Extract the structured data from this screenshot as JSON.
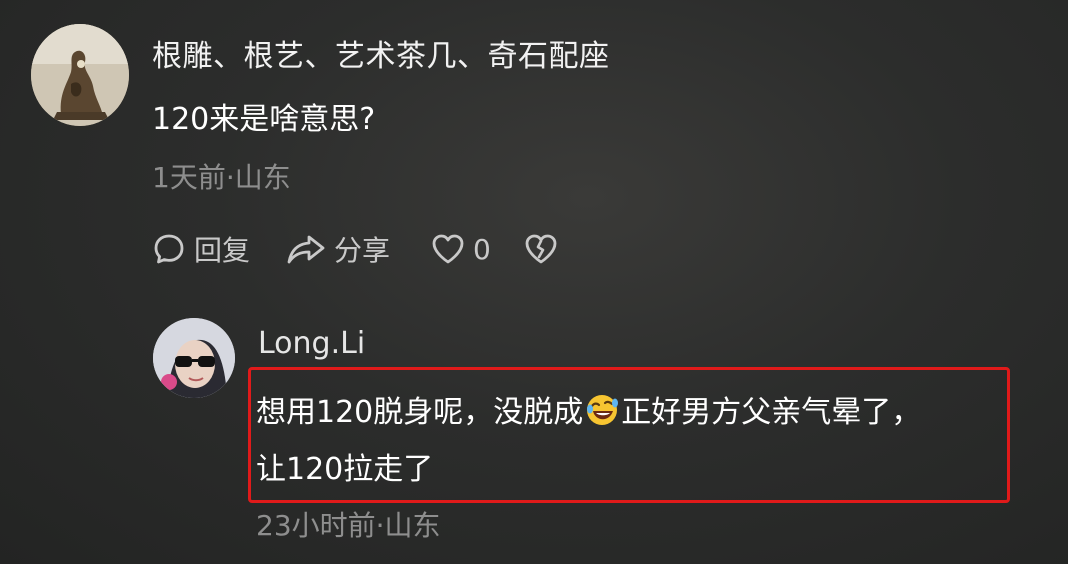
{
  "comment": {
    "username": "根雕、根艺、艺术茶几、奇石配座",
    "text": "120来是啥意思?",
    "meta": "1天前·山东",
    "actions": {
      "reply_label": "回复",
      "share_label": "分享",
      "like_count": "0"
    }
  },
  "reply": {
    "username": "Long.Li",
    "text_line1_before_emoji": "想用120脱身呢，没脱成",
    "emoji_icon": "rolling-on-floor-laughing-emoji",
    "text_line1_after_emoji": "正好男方父亲气晕了，",
    "text_line2": "让120拉走了",
    "meta": "23小时前·山东"
  },
  "colors": {
    "highlight_border": "#e01a1a",
    "meta_text": "#8e8e8e",
    "action_text": "#c9c9c9"
  }
}
